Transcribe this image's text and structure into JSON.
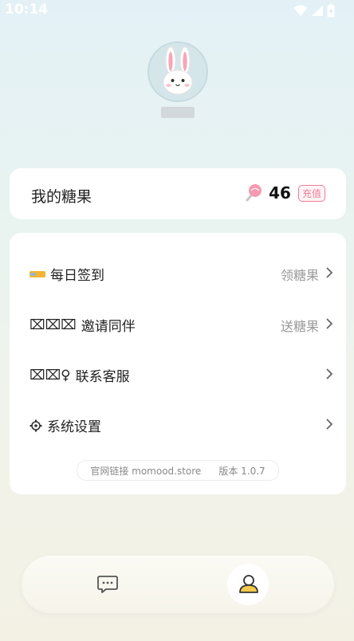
{
  "status_bar": {
    "time": "10:14",
    "icons": [
      "wifi-icon",
      "signal-icon",
      "battery-icon"
    ]
  },
  "profile": {
    "avatar_icon": "bunny-avatar",
    "username": ""
  },
  "candy_card": {
    "title": "我的糖果",
    "icon": "lollipop-icon",
    "count": "46",
    "recharge_label": "充值"
  },
  "menu": [
    {
      "prefix": "",
      "icon": "ticket-icon",
      "label": "每日签到",
      "action_text": "领糖果"
    },
    {
      "prefix": "⌧⌧⌧",
      "icon": "",
      "label": "邀请同伴",
      "action_text": "送糖果"
    },
    {
      "prefix": "⌧⌧♀",
      "icon": "",
      "label": "联系客服",
      "action_text": ""
    },
    {
      "prefix": "",
      "icon": "gear-icon",
      "label": "系统设置",
      "action_text": ""
    }
  ],
  "footer": {
    "site_label": "官网链接 momood.store",
    "version_label": "版本 1.0.7"
  },
  "bottom_nav": [
    {
      "name": "chat",
      "icon": "chat-bubble-icon"
    },
    {
      "name": "me",
      "icon": "user-icon",
      "active": true
    }
  ],
  "colors": {
    "accent_pink": "#ee7c94",
    "nav_active_yellow": "#f2c94c"
  }
}
